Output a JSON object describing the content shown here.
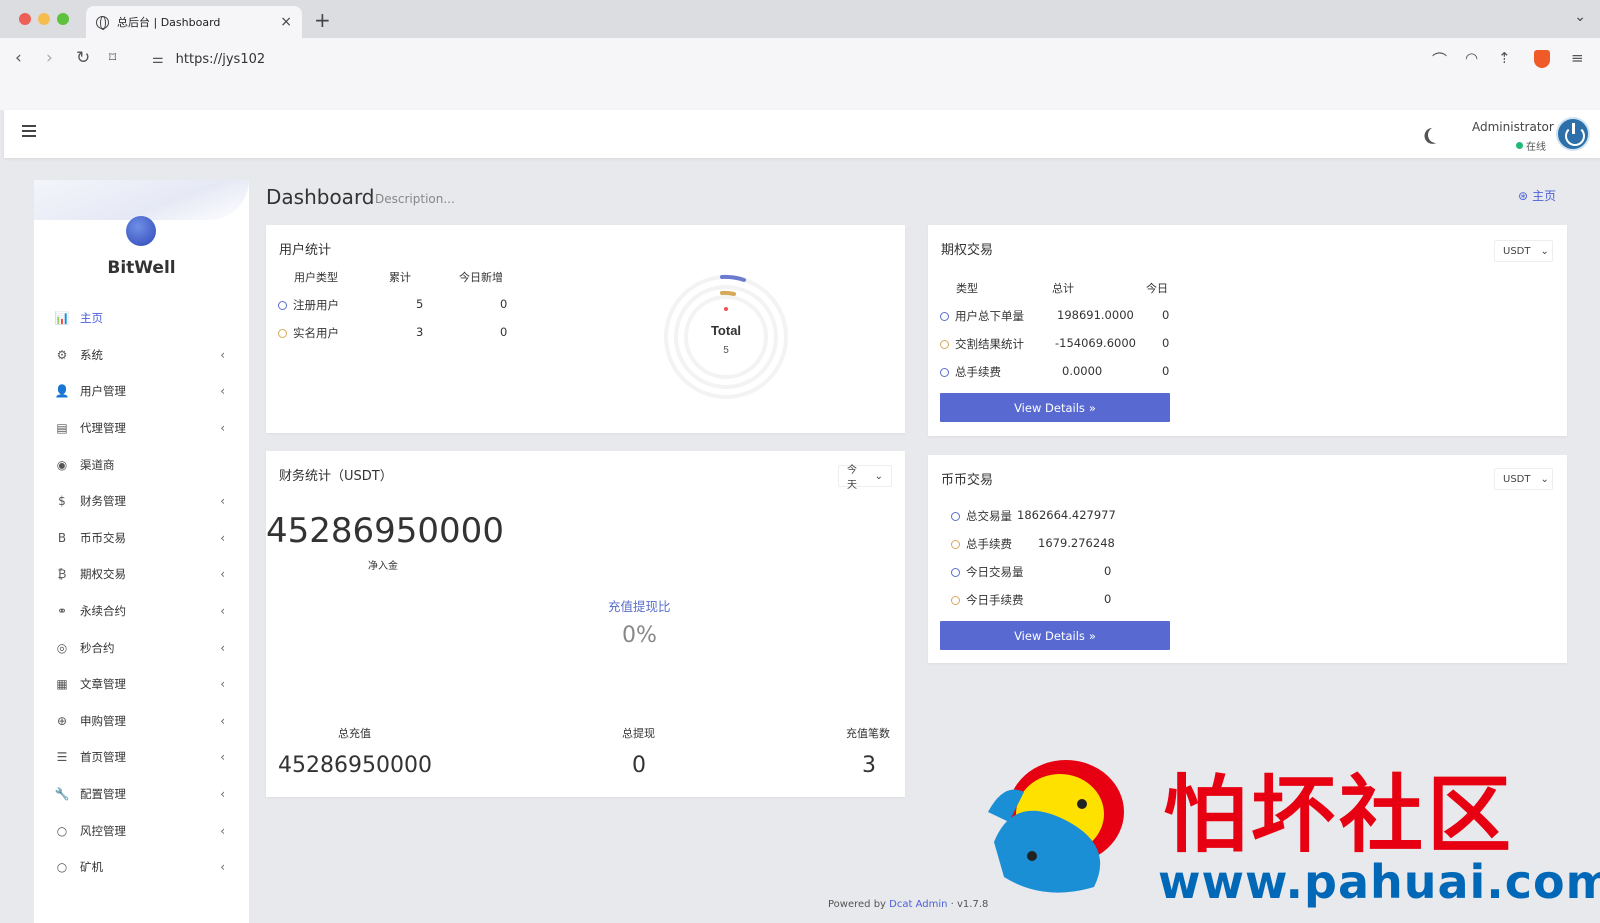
{
  "browser": {
    "tab_title": "总后台 | Dashboard",
    "url": "https://jys102",
    "traffic_colors": [
      "#ee5f57",
      "#f5bd4f",
      "#5ec23f"
    ]
  },
  "header": {
    "admin_name": "Administrator",
    "admin_status": "在线"
  },
  "sidebar": {
    "brand": "BitWell",
    "items": [
      {
        "label": "主页",
        "icon": "bar-chart-icon",
        "glyph": "📊",
        "chevron": false
      },
      {
        "label": "系统",
        "icon": "gear-icon",
        "glyph": "⚙",
        "chevron": true
      },
      {
        "label": "用户管理",
        "icon": "user-icon",
        "glyph": "👤",
        "chevron": true
      },
      {
        "label": "代理管理",
        "icon": "id-card-icon",
        "glyph": "▤",
        "chevron": true
      },
      {
        "label": "渠道商",
        "icon": "user-circle-icon",
        "glyph": "◉",
        "chevron": false
      },
      {
        "label": "财务管理",
        "icon": "dollar-icon",
        "glyph": "$",
        "chevron": true
      },
      {
        "label": "币币交易",
        "icon": "letter-b-icon",
        "glyph": "B",
        "chevron": true
      },
      {
        "label": "期权交易",
        "icon": "bitcoin-icon",
        "glyph": "₿",
        "chevron": true
      },
      {
        "label": "永续合约",
        "icon": "link-icon",
        "glyph": "⚭",
        "chevron": true
      },
      {
        "label": "秒合约",
        "icon": "target-icon",
        "glyph": "◎",
        "chevron": true
      },
      {
        "label": "文章管理",
        "icon": "newspaper-icon",
        "glyph": "▦",
        "chevron": true
      },
      {
        "label": "申购管理",
        "icon": "life-ring-icon",
        "glyph": "⊕",
        "chevron": true
      },
      {
        "label": "首页管理",
        "icon": "list-icon",
        "glyph": "☰",
        "chevron": true
      },
      {
        "label": "配置管理",
        "icon": "wrench-icon",
        "glyph": "🔧",
        "chevron": true
      },
      {
        "label": "风控管理",
        "icon": "circle-icon",
        "glyph": "○",
        "chevron": true
      },
      {
        "label": "矿机",
        "icon": "circle-icon",
        "glyph": "○",
        "chevron": true
      }
    ]
  },
  "page": {
    "title": "Dashboard",
    "description": "Description...",
    "breadcrumb": "主页"
  },
  "user_stats": {
    "title": "用户统计",
    "headers": [
      "用户类型",
      "累计",
      "今日新增"
    ],
    "rows": [
      {
        "type": "注册用户",
        "total": "5",
        "today": "0"
      },
      {
        "type": "实名用户",
        "total": "3",
        "today": "0"
      }
    ],
    "donut_label": "Total",
    "donut_value": "5"
  },
  "options_trade": {
    "title": "期权交易",
    "currency": "USDT",
    "headers": [
      "类型",
      "总计",
      "今日"
    ],
    "rows": [
      {
        "type": "用户总下单量",
        "total": "198691.0000",
        "today": "0"
      },
      {
        "type": "交割结果统计",
        "total": "-154069.6000",
        "today": "0"
      },
      {
        "type": "总手续费",
        "total": "0.0000",
        "today": "0"
      }
    ],
    "button": "View Details"
  },
  "finance": {
    "title": "财务统计（USDT）",
    "period": "今天",
    "net_value": "45286950000",
    "net_label": "净入金",
    "ratio_label": "充值提现比",
    "ratio_value": "0%",
    "stats": [
      {
        "label": "总充值",
        "value": "45286950000"
      },
      {
        "label": "总提现",
        "value": "0"
      },
      {
        "label": "充值笔数",
        "value": "3"
      }
    ]
  },
  "spot_trade": {
    "title": "币币交易",
    "currency": "USDT",
    "rows": [
      {
        "label": "总交易量",
        "value": "1862664.427977"
      },
      {
        "label": "总手续费",
        "value": "1679.276248"
      },
      {
        "label": "今日交易量",
        "value": "0"
      },
      {
        "label": "今日手续费",
        "value": "0"
      }
    ],
    "button": "View Details"
  },
  "footer": {
    "powered": "Powered by",
    "link": "Dcat Admin",
    "sep": "·",
    "version": "v1.7.8"
  },
  "watermark": {
    "cn": "怕坏社区",
    "url": "www.pahuai.com"
  }
}
